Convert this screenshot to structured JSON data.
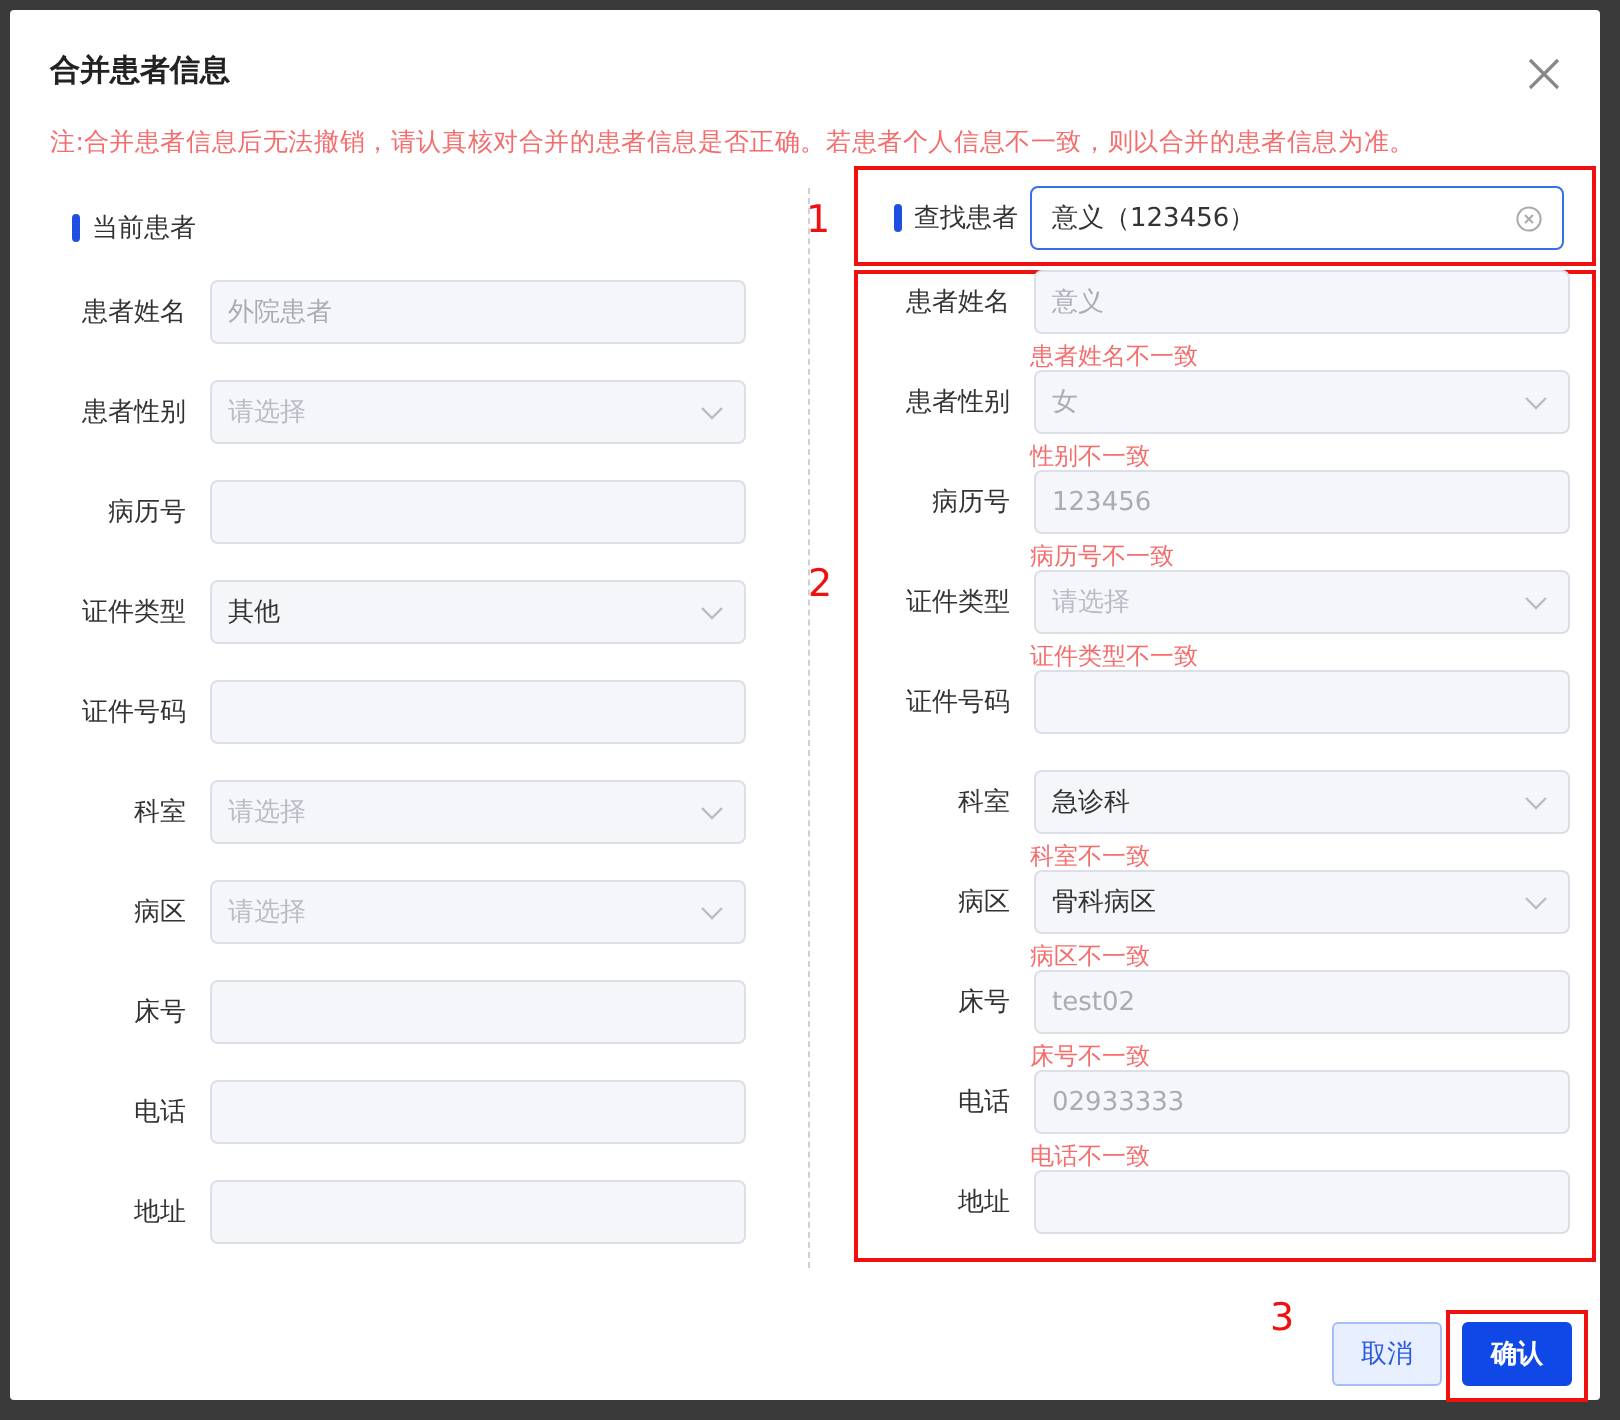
{
  "dialog": {
    "title": "合并患者信息",
    "note": "注:合并患者信息后无法撤销，请认真核对合并的患者信息是否正确。若患者个人信息不一致，则以合并的患者信息为准。",
    "current_patient": {
      "heading": "当前患者",
      "fields": [
        {
          "label": "患者姓名",
          "kind": "input",
          "value": "外院患者",
          "disabled": true
        },
        {
          "label": "患者性别",
          "kind": "select",
          "placeholder": "请选择"
        },
        {
          "label": "病历号",
          "kind": "input"
        },
        {
          "label": "证件类型",
          "kind": "select",
          "value": "其他",
          "disabled": false
        },
        {
          "label": "证件号码",
          "kind": "input"
        },
        {
          "label": "科室",
          "kind": "select",
          "placeholder": "请选择"
        },
        {
          "label": "病区",
          "kind": "select",
          "placeholder": "请选择"
        },
        {
          "label": "床号",
          "kind": "input"
        },
        {
          "label": "电话",
          "kind": "input"
        },
        {
          "label": "地址",
          "kind": "input"
        }
      ]
    },
    "search": {
      "label": "查找患者",
      "value": "意义（123456）"
    },
    "found_patient": {
      "fields": [
        {
          "label": "患者姓名",
          "kind": "input",
          "value": "意义",
          "disabled": true,
          "error": "患者姓名不一致"
        },
        {
          "label": "患者性别",
          "kind": "select",
          "value": "女",
          "disabled": true,
          "error": "性别不一致"
        },
        {
          "label": "病历号",
          "kind": "input",
          "value": "123456",
          "disabled": true,
          "error": "病历号不一致"
        },
        {
          "label": "证件类型",
          "kind": "select",
          "placeholder": "请选择",
          "error": "证件类型不一致"
        },
        {
          "label": "证件号码",
          "kind": "input"
        },
        {
          "label": "科室",
          "kind": "select",
          "value": "急诊科",
          "disabled": false,
          "error": "科室不一致"
        },
        {
          "label": "病区",
          "kind": "select",
          "value": "骨科病区",
          "disabled": false,
          "error": "病区不一致"
        },
        {
          "label": "床号",
          "kind": "input",
          "value": "test02",
          "disabled": true,
          "error": "床号不一致"
        },
        {
          "label": "电话",
          "kind": "input",
          "value": "02933333",
          "disabled": true,
          "error": "电话不一致"
        },
        {
          "label": "地址",
          "kind": "input"
        }
      ]
    },
    "buttons": [
      {
        "label": "取消",
        "kind": "secondary"
      },
      {
        "label": "确认",
        "kind": "primary"
      }
    ]
  },
  "annotations": [
    "1",
    "2",
    "3"
  ]
}
